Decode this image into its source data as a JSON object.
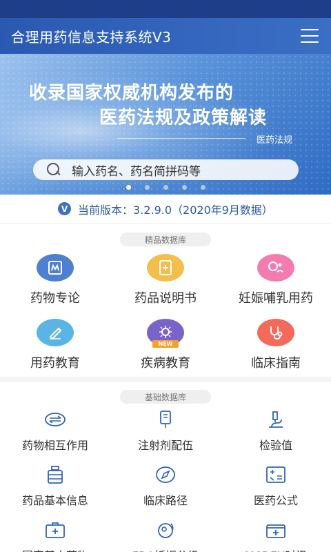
{
  "header": {
    "title": "合理用药信息支持系统V3",
    "menu_icon": "hamburger-icon"
  },
  "banner": {
    "line1": "收录国家权威机构发布的",
    "line2": "医药法规及政策解读",
    "tag": "医药法规",
    "search_placeholder": "输入药名、药名简拼码等",
    "slide_count": 5,
    "active_slide": 1
  },
  "version": {
    "icon": "V",
    "text": "当前版本：3.2.9.0（2020年9月数据）"
  },
  "premium": {
    "label": "精品数据库",
    "items": [
      {
        "label": "药物专论",
        "icon": "monograph-icon",
        "color": "#4f7fd0"
      },
      {
        "label": "药品说明书",
        "icon": "leaflet-icon",
        "color": "#f4be4a"
      },
      {
        "label": "妊娠哺乳用药",
        "icon": "pregnancy-icon",
        "color": "#f27cb0"
      },
      {
        "label": "用药教育",
        "icon": "pen-icon",
        "color": "#5ab4e6"
      },
      {
        "label": "疾病教育",
        "icon": "virus-icon",
        "color": "#7a63c8",
        "badge": "NEW"
      },
      {
        "label": "临床指南",
        "icon": "stethoscope-icon",
        "color": "#f3695a"
      }
    ]
  },
  "basic": {
    "label": "基础数据库",
    "items": [
      {
        "label": "药物相互作用",
        "icon": "interaction-icon"
      },
      {
        "label": "注射剂配伍",
        "icon": "infusion-icon"
      },
      {
        "label": "检验值",
        "icon": "microscope-icon"
      },
      {
        "label": "药品基本信息",
        "icon": "medicine-bottle-icon"
      },
      {
        "label": "临床路径",
        "icon": "compass-icon"
      },
      {
        "label": "医药公式",
        "icon": "formula-icon"
      },
      {
        "label": "国家基本药物",
        "icon": "medical-kit-icon"
      },
      {
        "label": "FDA妊娠分级",
        "icon": "fetus-icon"
      },
      {
        "label": "MCDEX时讯",
        "icon": "news-kit-icon"
      }
    ]
  },
  "colors": {
    "brand": "#2a59b2",
    "status_bar": "#1f3e8a",
    "version_text": "#2c56a4"
  }
}
